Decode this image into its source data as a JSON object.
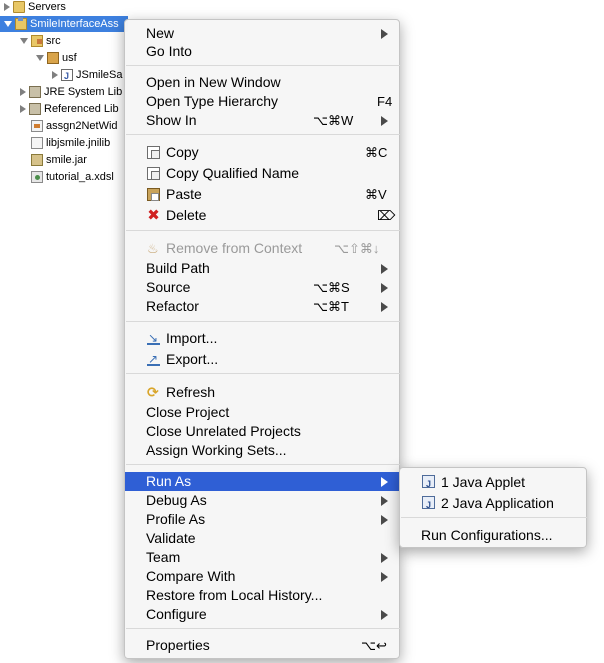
{
  "tree": {
    "items": [
      {
        "label": "Servers"
      },
      {
        "label": "SmileInterfaceAss"
      },
      {
        "label": "src"
      },
      {
        "label": "usf"
      },
      {
        "label": "JSmileSa"
      },
      {
        "label": "JRE System Lib"
      },
      {
        "label": "Referenced Lib"
      },
      {
        "label": "assgn2NetWid"
      },
      {
        "label": "libjsmile.jnilib"
      },
      {
        "label": "smile.jar"
      },
      {
        "label": "tutorial_a.xdsl"
      }
    ]
  },
  "menu": {
    "items": [
      {
        "label": "New"
      },
      {
        "label": "Go Into"
      },
      {
        "label": "Open in New Window"
      },
      {
        "label": "Open Type Hierarchy",
        "shortcut": "F4"
      },
      {
        "label": "Show In",
        "shortcut": "⌥⌘W"
      },
      {
        "label": "Copy",
        "shortcut": "⌘C",
        "icon": "copy-icon"
      },
      {
        "label": "Copy Qualified Name"
      },
      {
        "label": "Paste",
        "shortcut": "⌘V",
        "icon": "paste-icon"
      },
      {
        "label": "Delete",
        "shortcut": "⌦",
        "icon": "delete-icon"
      },
      {
        "label": "Remove from Context",
        "shortcut": "⌥⇧⌘↓",
        "icon": "remove-context-icon",
        "disabled": true
      },
      {
        "label": "Build Path"
      },
      {
        "label": "Source",
        "shortcut": "⌥⌘S"
      },
      {
        "label": "Refactor",
        "shortcut": "⌥⌘T"
      },
      {
        "label": "Import...",
        "icon": "import-icon"
      },
      {
        "label": "Export...",
        "icon": "export-icon"
      },
      {
        "label": "Refresh",
        "icon": "refresh-icon"
      },
      {
        "label": "Close Project"
      },
      {
        "label": "Close Unrelated Projects"
      },
      {
        "label": "Assign Working Sets..."
      },
      {
        "label": "Run As",
        "highlighted": true
      },
      {
        "label": "Debug As"
      },
      {
        "label": "Profile As"
      },
      {
        "label": "Validate"
      },
      {
        "label": "Team"
      },
      {
        "label": "Compare With"
      },
      {
        "label": "Restore from Local History..."
      },
      {
        "label": "Configure"
      },
      {
        "label": "Properties",
        "shortcut": "⌥↩"
      }
    ]
  },
  "submenu": {
    "items": [
      {
        "label": "1 Java Applet",
        "icon": "java-applet-icon"
      },
      {
        "label": "2 Java Application",
        "icon": "java-application-icon"
      },
      {
        "label": "Run Configurations..."
      }
    ]
  },
  "colors": {
    "selection": "#3d80df",
    "menu_highlight": "#2f5fd5",
    "menu_background": "#f6f6f6"
  }
}
